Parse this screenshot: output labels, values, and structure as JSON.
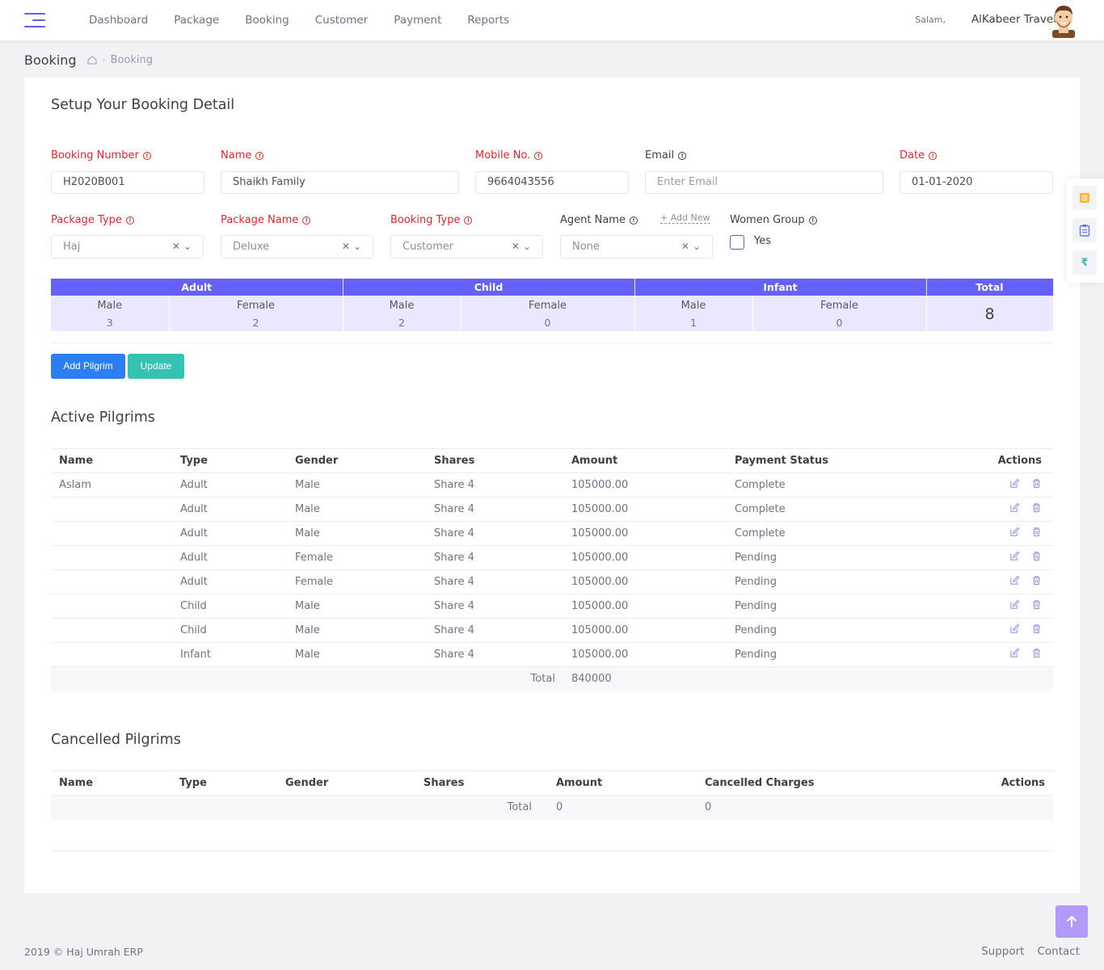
{
  "nav": [
    "Dashboard",
    "Package",
    "Booking",
    "Customer",
    "Payment",
    "Reports"
  ],
  "user": {
    "greeting": "Salam,",
    "name": "AlKabeer Travels"
  },
  "subheader": {
    "title": "Booking",
    "breadcrumb": "Booking"
  },
  "form": {
    "title": "Setup Your Booking Detail",
    "booking_number": {
      "label": "Booking Number",
      "value": "H2020B001"
    },
    "name": {
      "label": "Name",
      "value": "Shaikh Family"
    },
    "mobile": {
      "label": "Mobile No.",
      "value": "9664043556"
    },
    "email": {
      "label": "Email",
      "placeholder": "Enter Email"
    },
    "date": {
      "label": "Date",
      "value": "01-01-2020"
    },
    "package_type": {
      "label": "Package Type",
      "value": "Haj"
    },
    "package_name": {
      "label": "Package Name",
      "value": "Deluxe"
    },
    "booking_type": {
      "label": "Booking Type",
      "value": "Customer"
    },
    "agent_name": {
      "label": "Agent Name",
      "value": "None",
      "add_now": "+ Add New"
    },
    "women_group": {
      "label": "Women Group",
      "option": "Yes",
      "checked": false
    }
  },
  "counts": {
    "headers": {
      "adult": "Adult",
      "child": "Child",
      "infant": "Infant",
      "total": "Total"
    },
    "male_label": "Male",
    "female_label": "Female",
    "adult": {
      "male": "3",
      "female": "2"
    },
    "child": {
      "male": "2",
      "female": "0"
    },
    "infant": {
      "male": "1",
      "female": "0"
    },
    "total": "8"
  },
  "buttons": {
    "add_pilgrim": "Add Pilgrim",
    "update": "Update"
  },
  "active": {
    "title": "Active Pilgrims",
    "columns": [
      "Name",
      "Type",
      "Gender",
      "Shares",
      "Amount",
      "Payment Status",
      "Actions"
    ],
    "rows": [
      {
        "name": "Aslam",
        "type": "Adult",
        "gender": "Male",
        "shares": "Share 4",
        "amount": "105000.00",
        "status": "Complete"
      },
      {
        "name": "",
        "type": "Adult",
        "gender": "Male",
        "shares": "Share 4",
        "amount": "105000.00",
        "status": "Complete"
      },
      {
        "name": "",
        "type": "Adult",
        "gender": "Male",
        "shares": "Share 4",
        "amount": "105000.00",
        "status": "Complete"
      },
      {
        "name": "",
        "type": "Adult",
        "gender": "Female",
        "shares": "Share 4",
        "amount": "105000.00",
        "status": "Pending"
      },
      {
        "name": "",
        "type": "Adult",
        "gender": "Female",
        "shares": "Share 4",
        "amount": "105000.00",
        "status": "Pending"
      },
      {
        "name": "",
        "type": "Child",
        "gender": "Male",
        "shares": "Share 4",
        "amount": "105000.00",
        "status": "Pending"
      },
      {
        "name": "",
        "type": "Child",
        "gender": "Male",
        "shares": "Share 4",
        "amount": "105000.00",
        "status": "Pending"
      },
      {
        "name": "",
        "type": "Infant",
        "gender": "Male",
        "shares": "Share 4",
        "amount": "105000.00",
        "status": "Pending"
      }
    ],
    "total_label": "Total",
    "total_amount": "840000"
  },
  "cancelled": {
    "title": "Cancelled Pilgrims",
    "columns": [
      "Name",
      "Type",
      "Gender",
      "Shares",
      "Amount",
      "Cancelled Charges",
      "Actions"
    ],
    "total_label": "Total",
    "total_amount": "0",
    "total_charges": "0"
  },
  "footer": {
    "copyright": "2019 © Haj Umrah ERP",
    "links": [
      "Support",
      "Contact"
    ]
  },
  "colors": {
    "accent": "#6560f7",
    "required": "#e5252a",
    "primary": "#2b7ff3",
    "success": "#36c2b2"
  }
}
